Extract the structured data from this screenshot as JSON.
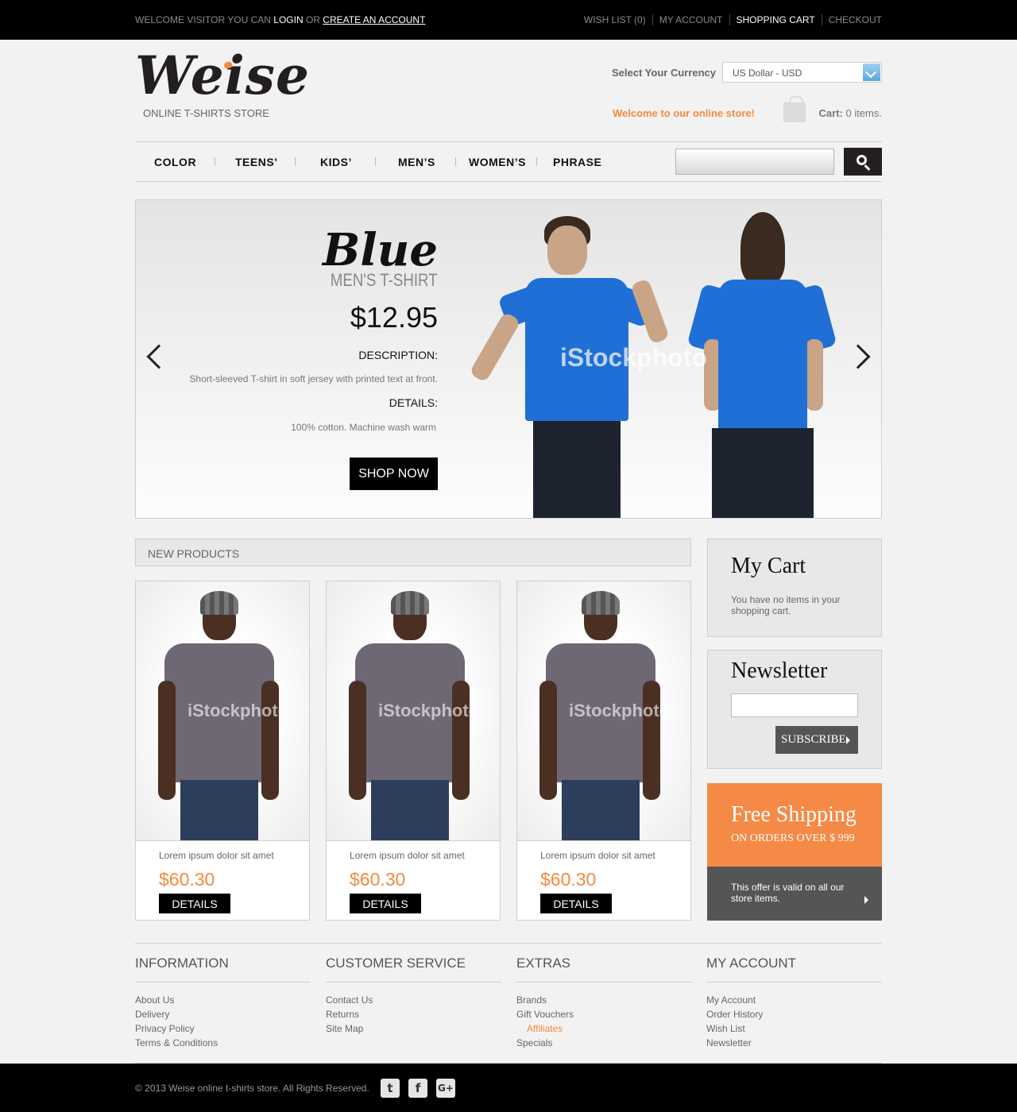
{
  "topbar": {
    "welcome_prefix": "WELCOME VISITOR YOU CAN",
    "login": "LOGIN",
    "or": "OR",
    "create_account": "CREATE AN ACCOUNT",
    "links": [
      "WISH LIST (0)",
      "MY ACCOUNT",
      "SHOPPING CART",
      "CHECKOUT"
    ]
  },
  "header": {
    "logo": "Weise",
    "tagline": "ONLINE T-SHIRTS STORE",
    "currency_label": "Select Your Currency",
    "currency_value": "US Dollar - USD",
    "welcome": "Welcome to our online store!",
    "cart_label": "Cart:",
    "cart_value": "0 items."
  },
  "nav": {
    "items": [
      "COLOR",
      "TEENS’",
      "KIDS’",
      "MEN’S",
      "WOMEN’S",
      "PHRASE"
    ]
  },
  "hero": {
    "title": "Blue",
    "subtitle": "MEN'S T-SHIRT",
    "price": "$12.95",
    "description_heading": "DESCRIPTION:",
    "description": "Short-sleeved T-shirt in soft jersey with printed text at front.",
    "details_heading": "DETAILS:",
    "details": "100% cotton. Machine wash warm",
    "cta": "SHOP NOW",
    "watermark": "iStockphoto"
  },
  "new_products": {
    "heading": "NEW PRODUCTS",
    "items": [
      {
        "name": "Lorem ipsum dolor sit amet",
        "price": "$60.30",
        "cta": "DETAILS",
        "watermark": "iStockphoto"
      },
      {
        "name": "Lorem ipsum dolor sit amet",
        "price": "$60.30",
        "cta": "DETAILS",
        "watermark": "iStockphoto"
      },
      {
        "name": "Lorem ipsum dolor sit amet",
        "price": "$60.30",
        "cta": "DETAILS",
        "watermark": "iStockphoto"
      }
    ]
  },
  "sidebar": {
    "cart_title": "My Cart",
    "cart_text": "You have no items in your shopping cart.",
    "newsletter_title": "Newsletter",
    "subscribe": "SUBSCRIBE",
    "shipping_title": "Free Shipping",
    "shipping_sub": "ON ORDERS OVER $ 999",
    "offer_text": "This offer is valid on all our store items."
  },
  "footer": {
    "columns": [
      {
        "heading": "INFORMATION",
        "links": [
          "About Us",
          "Delivery",
          "Privacy Policy",
          "Terms & Conditions"
        ]
      },
      {
        "heading": "CUSTOMER SERVICE",
        "links": [
          "Contact Us",
          "Returns",
          "Site Map"
        ]
      },
      {
        "heading": "EXTRAS",
        "links": [
          "Brands",
          "Gift Vouchers",
          "Affiliates",
          "Specials"
        ]
      },
      {
        "heading": "MY ACCOUNT",
        "links": [
          "My Account",
          "Order History",
          "Wish List",
          "Newsletter"
        ]
      }
    ],
    "copyright": "© 2013 Weise online t-shirts store. All Rights Reserved.",
    "social": [
      "twitter-icon",
      "facebook-icon",
      "google-plus-icon"
    ]
  },
  "colors": {
    "accent": "#f58a3c",
    "dark": "#000000",
    "panel": "#e8e8e8"
  }
}
